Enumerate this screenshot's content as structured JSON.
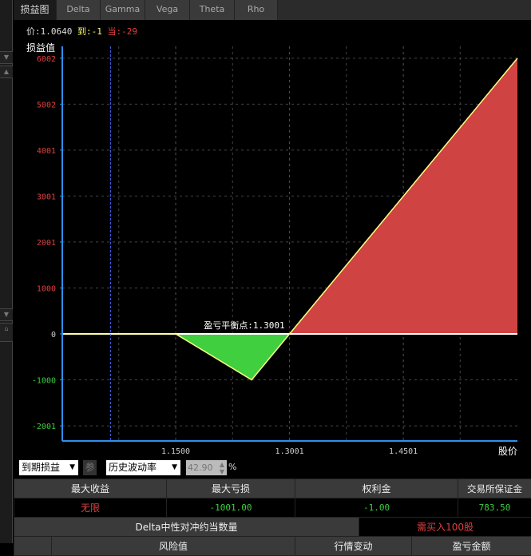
{
  "tabs": [
    "损益图",
    "Delta",
    "Gamma",
    "Vega",
    "Theta",
    "Rho"
  ],
  "info": {
    "price_label": "价:1.0640",
    "expiry_label": "到:-1",
    "current_label": "当:-29"
  },
  "colors": {
    "profit": "#d04343",
    "loss": "#3fcf3f",
    "line": "#ffff80",
    "axis": "#2f8fef",
    "price_line": "#4a6cff"
  },
  "chart_data": {
    "type": "area",
    "ylabel": "损益值",
    "xlabel": "股价",
    "x": [
      1.0005,
      1.15,
      1.2501,
      1.3001,
      1.6005
    ],
    "y": [
      0,
      0,
      -1000,
      0,
      6002
    ],
    "xlim": [
      1.0005,
      1.6005
    ],
    "ylim": [
      -2330,
      6260
    ],
    "xticks": [
      1.15,
      1.3001,
      1.4501
    ],
    "xtick_labels": [
      "1.1500",
      "1.3001",
      "1.4501"
    ],
    "yticks": [
      6002,
      5002,
      4001,
      3001,
      2001,
      1000,
      0,
      -1000,
      -2001
    ],
    "ytick_labels": [
      "6002",
      "5002",
      "4001",
      "3001",
      "2001",
      "1000",
      "0",
      "-1000",
      "-2001"
    ],
    "current_price": 1.064,
    "annotation": "盈亏平衡点:1.3001",
    "breakeven": 1.3001,
    "grid": true
  },
  "controls": {
    "mode": "到期损益",
    "param_btn": "参",
    "vol_type": "历史波动率",
    "vol_value": "42.90",
    "unit": "%"
  },
  "summary": {
    "headers": [
      "最大收益",
      "最大亏损",
      "权利金",
      "交易所保证金"
    ],
    "values": [
      "无限",
      "-1001.00",
      "-1.00",
      "783.50"
    ],
    "hedge_label": "Delta中性对冲约当数量",
    "hedge_value": "需买入100股",
    "risk_headers": [
      "",
      "风险值",
      "行情变动",
      "盈亏金额"
    ]
  }
}
